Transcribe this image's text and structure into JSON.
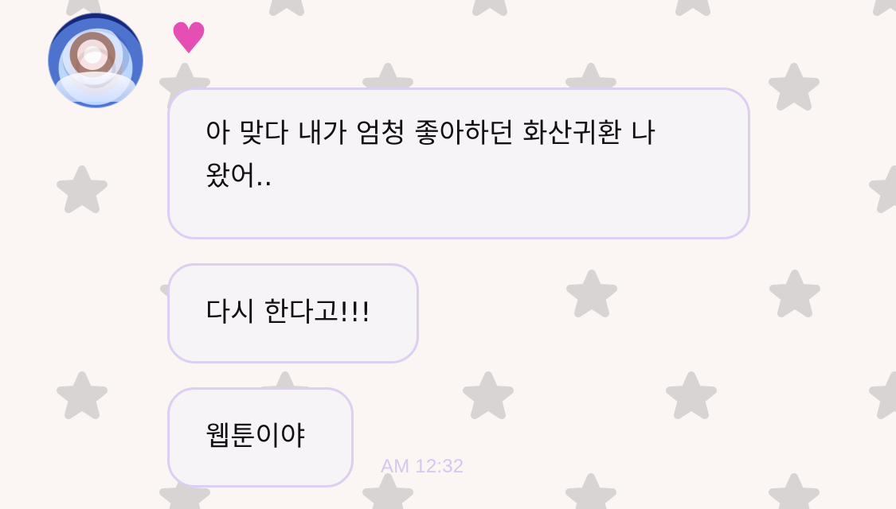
{
  "conversation": {
    "reaction_icon": "pink-heart-icon",
    "avatar_icon": "profile-photo",
    "messages": [
      {
        "text": "아 맞다 내가 엄청 좋아하던 화산귀환 나\n왔어.."
      },
      {
        "text": "다시 한다고!!!"
      },
      {
        "text": "웹툰이야"
      }
    ],
    "timestamp": "AM 12:32"
  },
  "colors": {
    "background": "#fbf6f4",
    "star": "#d6d2d2",
    "bubble_fill": "#f7f4f8",
    "bubble_border": "#dccff1",
    "heart": "#e54fb4",
    "timestamp": "#d4c7f0"
  }
}
